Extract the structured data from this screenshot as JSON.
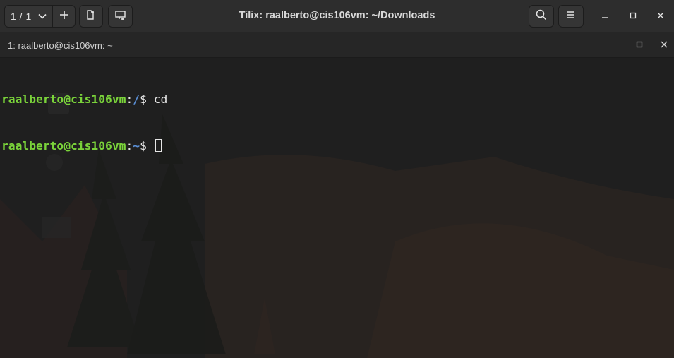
{
  "window": {
    "title": "Tilix: raalberto@cis106vm: ~/Downloads"
  },
  "header": {
    "session_count": "1 / 1",
    "icons": {
      "session_dropdown": "chevron-down-icon",
      "add_session": "plus-icon",
      "add_terminal_right": "split-right-icon",
      "add_terminal_down": "split-down-icon",
      "search": "search-icon",
      "menu": "hamburger-menu-icon",
      "minimize": "minimize-icon",
      "maximize": "maximize-icon",
      "close": "close-icon"
    }
  },
  "terminal_bar": {
    "title": "1: raalberto@cis106vm: ~",
    "icons": {
      "maximize": "maximize-icon",
      "close": "close-icon"
    }
  },
  "terminal": {
    "lines": [
      {
        "user": "raalberto@cis106vm",
        "sep": ":",
        "path": "/",
        "prompt": "$ ",
        "command": "cd"
      },
      {
        "user": "raalberto@cis106vm",
        "sep": ":",
        "path": "~",
        "prompt": "$ ",
        "command": ""
      }
    ]
  },
  "colors": {
    "prompt_user": "#7ad33a",
    "prompt_path": "#5a8fd6",
    "text": "#e6e6e6",
    "background": "#1f1f1f",
    "headerbar": "#2d2d2d"
  }
}
